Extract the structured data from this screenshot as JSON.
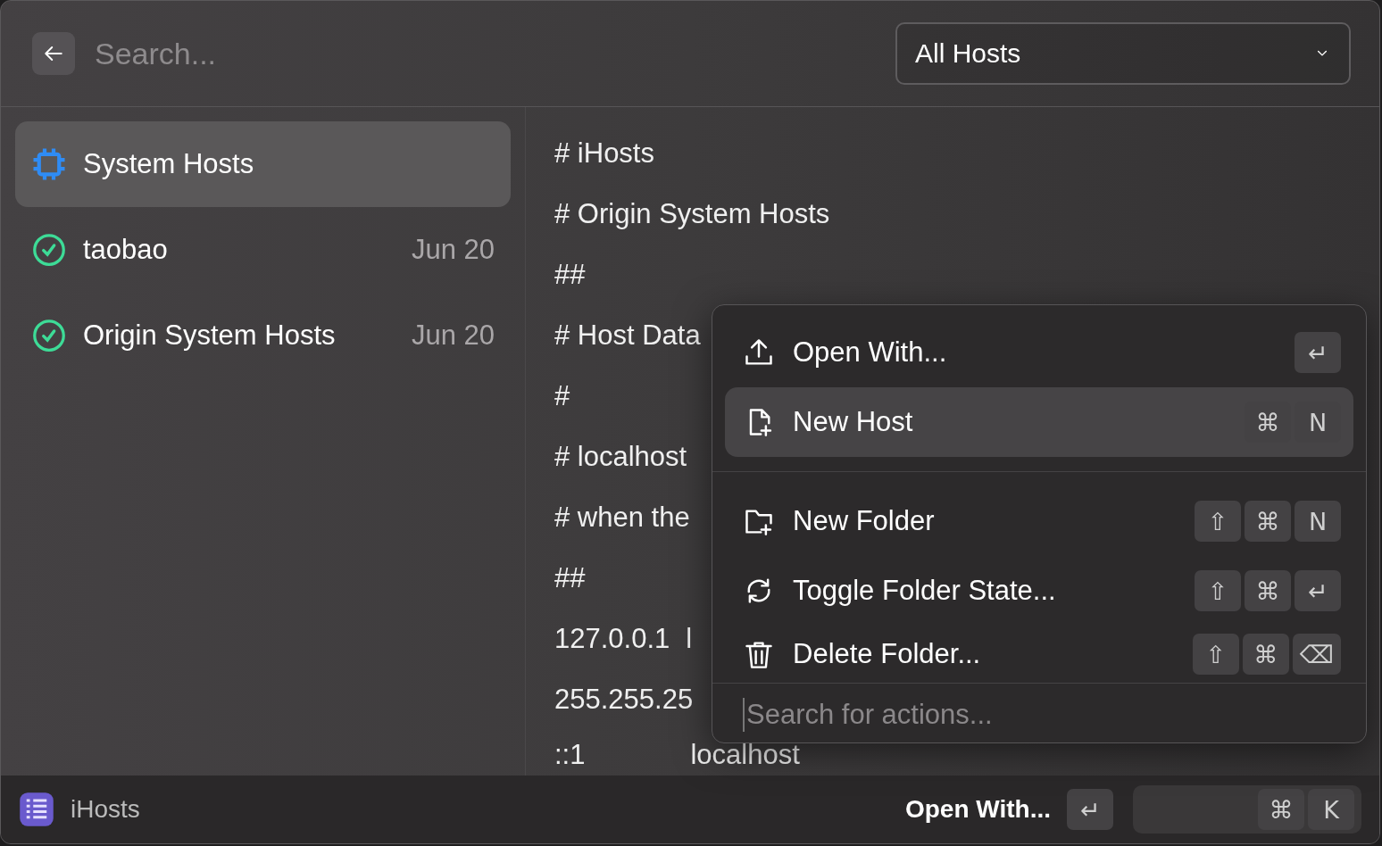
{
  "search": {
    "placeholder": "Search..."
  },
  "filter": {
    "value": "All Hosts"
  },
  "sidebar": {
    "items": [
      {
        "label": "System Hosts",
        "kind": "system",
        "selected": true
      },
      {
        "label": "taobao",
        "date": "Jun 20",
        "kind": "host",
        "enabled": true,
        "selected": false
      },
      {
        "label": "Origin System Hosts",
        "date": "Jun 20",
        "kind": "host",
        "enabled": true,
        "selected": false
      }
    ]
  },
  "editor": {
    "lines": [
      [
        "# iHosts"
      ],
      [
        "# Origin System Hosts"
      ],
      [
        "##"
      ],
      [
        "# Host Data"
      ],
      [
        "#"
      ],
      [
        "# localhost"
      ],
      [
        "# when the"
      ],
      [
        "##"
      ],
      [
        "127.0.0.1",
        "l"
      ],
      [
        "255.255.25"
      ],
      [
        "::1",
        "localhost"
      ]
    ]
  },
  "actions_menu": {
    "sections": [
      [
        {
          "label": "Open With...",
          "kind": "upload",
          "keys": [
            "↵"
          ],
          "selected": false
        },
        {
          "label": "New Host",
          "kind": "new-file",
          "keys": [
            "⌘",
            "N"
          ],
          "selected": true
        }
      ],
      [
        {
          "label": "New Folder",
          "kind": "new-folder",
          "keys": [
            "⇧",
            "⌘",
            "N"
          ],
          "selected": false
        },
        {
          "label": "Toggle Folder State...",
          "kind": "toggle",
          "keys": [
            "⇧",
            "⌘",
            "↵"
          ],
          "selected": false
        },
        {
          "label": "Delete Folder...",
          "kind": "delete",
          "keys": [
            "⇧",
            "⌘",
            "⌫"
          ],
          "selected": false
        }
      ]
    ],
    "search": {
      "placeholder": "Search for actions..."
    }
  },
  "footer": {
    "app_name": "iHosts",
    "primary_action": {
      "label": "Open With...",
      "keys": [
        "↵"
      ]
    },
    "actions_button": {
      "keys": [
        "⌘",
        "K"
      ]
    }
  }
}
